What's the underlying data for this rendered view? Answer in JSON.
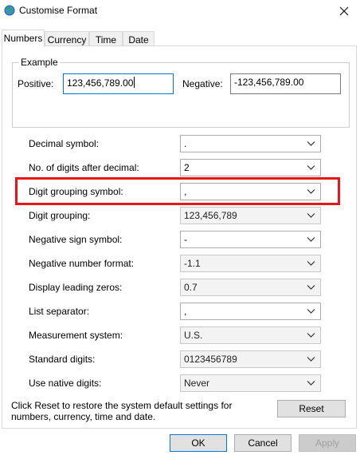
{
  "window": {
    "title": "Customise Format"
  },
  "tabs": [
    {
      "label": "Numbers",
      "active": true
    },
    {
      "label": "Currency",
      "active": false
    },
    {
      "label": "Time",
      "active": false
    },
    {
      "label": "Date",
      "active": false
    }
  ],
  "example": {
    "group_label": "Example",
    "positive_label": "Positive:",
    "positive_value": "123,456,789.00",
    "negative_label": "Negative:",
    "negative_value": "-123,456,789.00"
  },
  "settings": [
    {
      "label": "Decimal symbol:",
      "value": "."
    },
    {
      "label": "No. of digits after decimal:",
      "value": "2"
    },
    {
      "label": "Digit grouping symbol:",
      "value": ","
    },
    {
      "label": "Digit grouping:",
      "value": "123,456,789"
    },
    {
      "label": "Negative sign symbol:",
      "value": "-"
    },
    {
      "label": "Negative number format:",
      "value": "-1.1"
    },
    {
      "label": "Display leading zeros:",
      "value": "0.7"
    },
    {
      "label": "List separator:",
      "value": ","
    },
    {
      "label": "Measurement system:",
      "value": "U.S."
    },
    {
      "label": "Standard digits:",
      "value": "0123456789"
    },
    {
      "label": "Use native digits:",
      "value": "Never"
    }
  ],
  "reset_note": "Click Reset to restore the system default settings for numbers, currency, time and date.",
  "buttons": {
    "reset": "Reset",
    "ok": "OK",
    "cancel": "Cancel",
    "apply": "Apply"
  },
  "colors": {
    "highlight": "#e8151b",
    "focus_border": "#0078d7"
  }
}
